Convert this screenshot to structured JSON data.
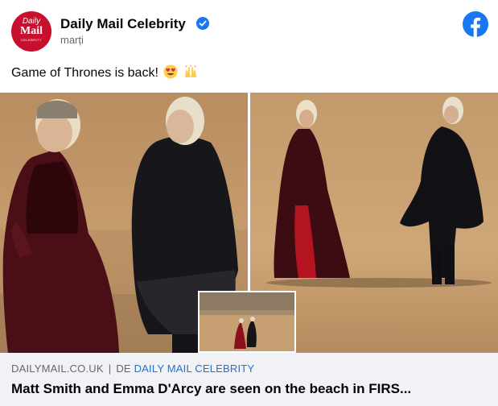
{
  "header": {
    "avatar_line1": "Daily",
    "avatar_line2": "Mail",
    "avatar_line3": "CELEBRITY",
    "page_name": "Daily Mail Celebrity",
    "post_time": "marți",
    "verified_icon": "verified-badge-icon",
    "network_icon": "facebook-logo-icon"
  },
  "post": {
    "text": "Game of Thrones is back!",
    "emojis": [
      "heart-eyes-emoji",
      "raised-hands-emoji"
    ]
  },
  "link_preview": {
    "domain": "DAILYMAIL.CO.UK",
    "separator": "|",
    "prefix": "DE",
    "publisher": "DAILY MAIL CELEBRITY",
    "headline": "Matt Smith and Emma D'Arcy are seen on the beach in FIRS..."
  },
  "colors": {
    "brand_red": "#c8102e",
    "facebook_blue": "#1877f2",
    "link_blue": "#216fdb",
    "preview_bg": "#f0f2f5"
  }
}
